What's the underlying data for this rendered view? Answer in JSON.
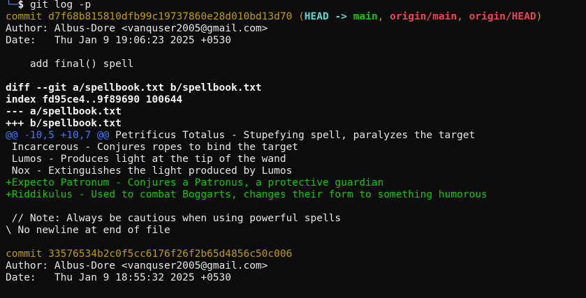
{
  "prompt": {
    "corner": "└─",
    "symbol": "$",
    "command": "git log -p"
  },
  "commits": [
    {
      "keyword": "commit",
      "hash": "d7f68b815810dfb99c19737860e28d010bd13d70",
      "decorations": {
        "open": "(",
        "head": "HEAD ->",
        "main": "main",
        "sep1": ", ",
        "origin_main": "origin/main",
        "sep2": ", ",
        "origin_head": "origin/HEAD",
        "close": ")"
      },
      "author_line": "Author: Albus-Dore <vanquser2005@gmail.com>",
      "date_line": "Date:   Thu Jan 9 19:06:23 2025 +0530",
      "message": "    add final() spell"
    },
    {
      "keyword": "commit",
      "hash": "33576534b2c0f5cc6176f26f2b65d4856c50c006",
      "author_line": "Author: Albus-Dore <vanquser2005@gmail.com>",
      "date_line": "Date:   Thu Jan 9 18:55:32 2025 +0530"
    }
  ],
  "diff": {
    "header": "diff --git a/spellbook.txt b/spellbook.txt",
    "index": "index fd95ce4..9f89690 100644",
    "from_file": "--- a/spellbook.txt",
    "to_file": "+++ b/spellbook.txt",
    "hunk_range": "@@ -10,5 +10,7 @@",
    "hunk_context": " Petrificus Totalus - Stupefying spell, paralyzes the target",
    "context_lines": [
      " Incarcerous - Conjures ropes to bind the target",
      " Lumos - Produces light at the tip of the wand",
      " Nox - Extinguishes the light produced by Lumos"
    ],
    "added_lines": [
      "+Expecto Patronum - Conjures a Patronus, a protective guardian",
      "+Riddikulus - Used to combat Boggarts, changes their form to something humorous"
    ],
    "trailing_context": " // Note: Always be cautious when using powerful spells",
    "no_newline": "\\ No newline at end of file"
  },
  "colors": {
    "background": "#0c0c0c",
    "text": "#e6e6e6",
    "commit": "#c19c00",
    "head": "#61d6d6",
    "branch": "#16c60c",
    "remote": "#e74856",
    "hunk": "#3b78ff",
    "added": "#16c60c",
    "prompt_corner": "#3a8dde"
  }
}
